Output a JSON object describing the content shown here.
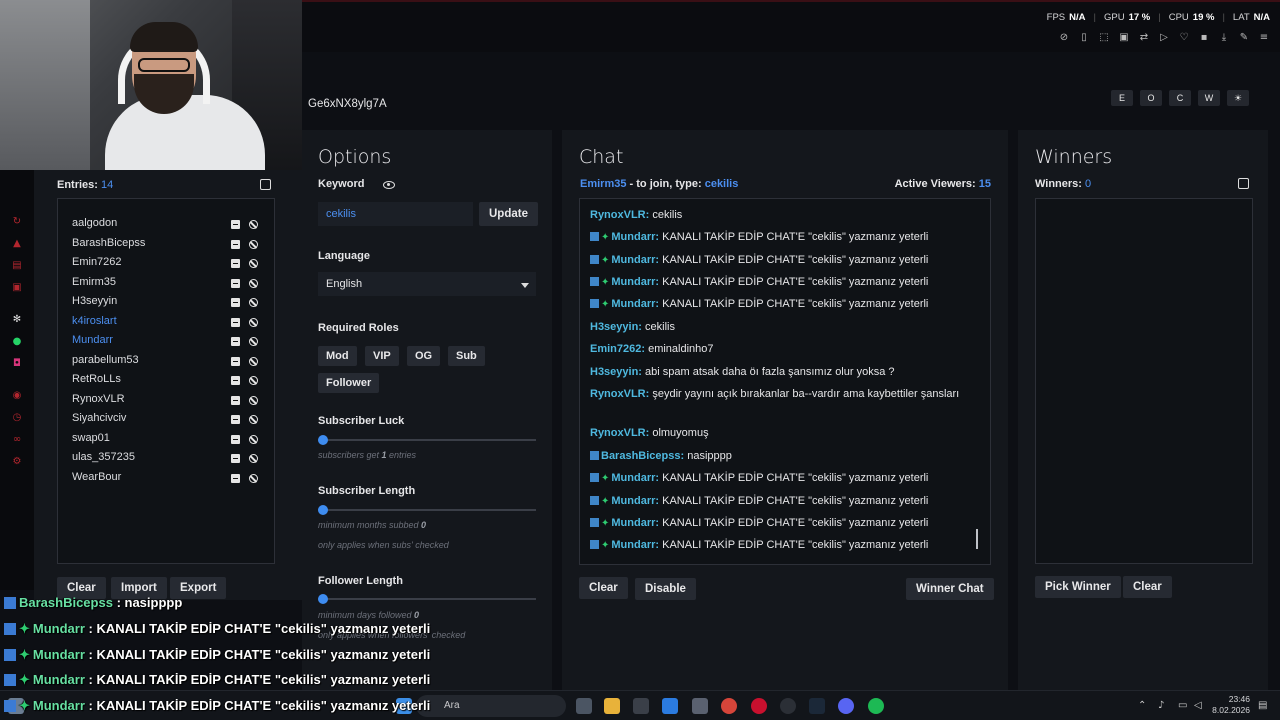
{
  "topbar": {
    "stats": [
      {
        "label": "FPS",
        "value": "N/A"
      },
      {
        "label": "GPU",
        "value": "17 %"
      },
      {
        "label": "CPU",
        "value": "19 %"
      },
      {
        "label": "LAT",
        "value": "N/A"
      }
    ]
  },
  "app": {
    "id": "Ge6xNX8ylg7A",
    "mode_buttons": [
      "E",
      "O",
      "C",
      "W",
      "☀"
    ]
  },
  "entries": {
    "label": "Entries:",
    "count": "14",
    "items": [
      "aalgodon",
      "BarashBicepss",
      "Emin7262",
      "Emirm35",
      "H3seyyin",
      "k4iroslart",
      "Mundarr",
      "parabellum53",
      "RetRoLLs",
      "RynoxVLR",
      "Siyahcivciv",
      "swap01",
      "ulas_357235",
      "WearBour"
    ],
    "buttons": {
      "clear": "Clear",
      "import": "Import",
      "export": "Export"
    }
  },
  "options": {
    "title": "Options",
    "keyword_label": "Keyword",
    "keyword_value": "cekilis",
    "update_label": "Update",
    "language_label": "Language",
    "language_value": "English",
    "roles_label": "Required Roles",
    "roles": [
      "Mod",
      "VIP",
      "OG",
      "Sub",
      "Follower"
    ],
    "sub_luck_label": "Subscriber Luck",
    "sub_luck_hint_a": "subscribers get ",
    "sub_luck_hint_b": "1",
    "sub_luck_hint_c": " entries",
    "sub_length_label": "Subscriber Length",
    "sub_length_hint_a": "minimum months subbed ",
    "sub_length_hint_b": "0",
    "sub_length_hint2": "only applies when subs' checked",
    "follow_length_label": "Follower Length",
    "follow_length_hint_a": "minimum days followed ",
    "follow_length_hint_b": "0",
    "follow_length_hint2": "only applies when followers' checked",
    "sub_luck_level": 0,
    "sub_length_level": 0,
    "follow_length_level": 0
  },
  "chat": {
    "title": "Chat",
    "join_user": "Emirm35",
    "join_text": " - to join, type: ",
    "join_keyword": "cekilis",
    "viewers_label": "Active Viewers:",
    "viewers_count": "15",
    "messages": [
      {
        "user": "RynoxVLR:",
        "text": " cekilis",
        "badge": false
      },
      {
        "user": "Mundarr:",
        "text": " KANALI TAKİP EDİP CHAT'E \"cekilis\" yazmanız yeterli",
        "badge": true
      },
      {
        "user": "Mundarr:",
        "text": " KANALI TAKİP EDİP CHAT'E \"cekilis\" yazmanız yeterli",
        "badge": true
      },
      {
        "user": "Mundarr:",
        "text": " KANALI TAKİP EDİP CHAT'E \"cekilis\" yazmanız yeterli",
        "badge": true
      },
      {
        "user": "Mundarr:",
        "text": " KANALI TAKİP EDİP CHAT'E \"cekilis\" yazmanız yeterli",
        "badge": true
      },
      {
        "user": "H3seyyin:",
        "text": " cekilis",
        "badge": false
      },
      {
        "user": "Emin7262:",
        "text": " eminaldinho7",
        "badge": false
      },
      {
        "user": "H3seyyin:",
        "text": " abi spam atsak daha öı fazla şansımız olur yoksa ?",
        "badge": false
      },
      {
        "user": "RynoxVLR:",
        "text": " şeydir yayını açık bırakanlar ba--vardır ama kaybettiler şansları",
        "badge": false
      },
      {
        "user": "RynoxVLR:",
        "text": " olmuyomuş",
        "badge": false
      },
      {
        "user": "BarashBicepss:",
        "text": " nasipppp",
        "badge": "sub"
      },
      {
        "user": "Mundarr:",
        "text": " KANALI TAKİP EDİP CHAT'E \"cekilis\" yazmanız yeterli",
        "badge": true
      },
      {
        "user": "Mundarr:",
        "text": " KANALI TAKİP EDİP CHAT'E \"cekilis\" yazmanız yeterli",
        "badge": true
      },
      {
        "user": "Mundarr:",
        "text": " KANALI TAKİP EDİP CHAT'E \"cekilis\" yazmanız yeterli",
        "badge": true
      },
      {
        "user": "Mundarr:",
        "text": " KANALI TAKİP EDİP CHAT'E \"cekilis\" yazmanız yeterli",
        "badge": true
      }
    ],
    "buttons": {
      "clear": "Clear",
      "disable": "Disable",
      "winner_chat": "Winner Chat"
    }
  },
  "winners": {
    "title": "Winners",
    "label": "Winners:",
    "count": "0",
    "buttons": {
      "pick": "Pick Winner",
      "clear": "Clear"
    }
  },
  "overlay": [
    {
      "user": "BarashBicepss",
      "text": " : nasipppp"
    },
    {
      "user": "Mundarr",
      "text": " : KANALI TAKİP EDİP CHAT'E \"cekilis\" yazmanız yeterli"
    },
    {
      "user": "Mundarr",
      "text": " : KANALI TAKİP EDİP CHAT'E \"cekilis\" yazmanız yeterli"
    },
    {
      "user": "Mundarr",
      "text": " : KANALI TAKİP EDİP CHAT'E \"cekilis\" yazmanız yeterli"
    },
    {
      "user": "Mundarr",
      "text": " : KANALI TAKİP EDİP CHAT'E \"cekilis\" yazmanız yeterli"
    }
  ],
  "taskbar": {
    "search_placeholder": "Ara",
    "time": "23:46",
    "date": "8.02.2026"
  },
  "colors": {
    "accent": "#4c8ff0",
    "background": "#0d0f14",
    "panel": "#14171c",
    "overlay_user": "#67e0a3"
  }
}
